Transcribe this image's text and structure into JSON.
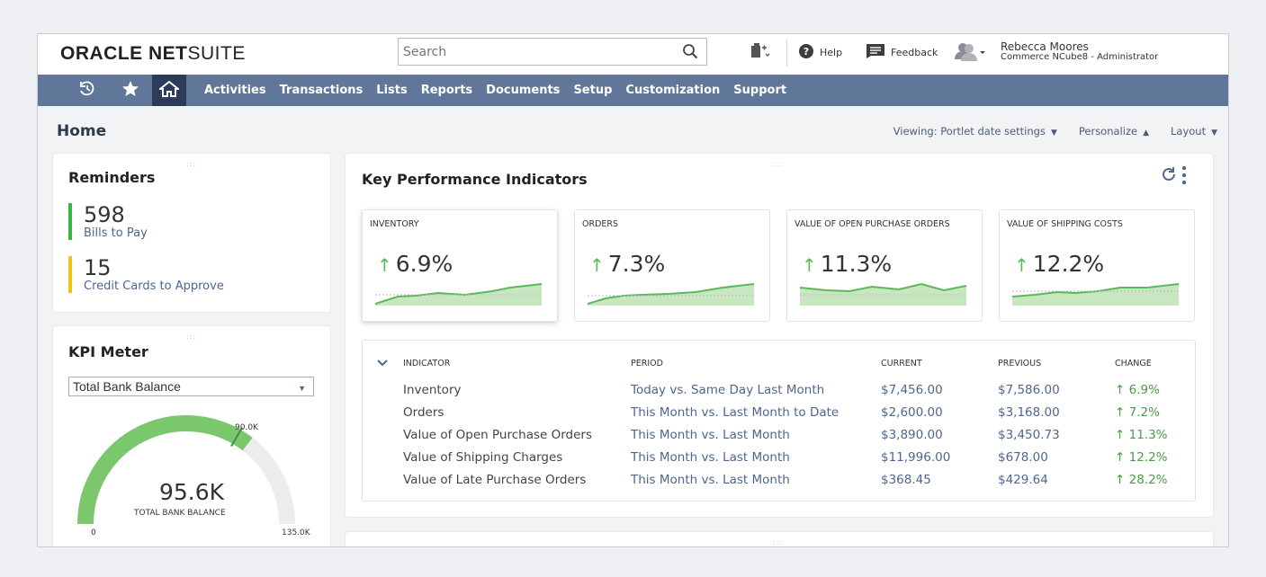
{
  "header": {
    "logo_bold": "ORACLE NET",
    "logo_light": "SUITE",
    "search": {
      "placeholder": "Search",
      "value": ""
    },
    "help_label": "Help",
    "feedback_label": "Feedback",
    "user_name": "Rebecca Moores",
    "user_role": "Commerce NCube8 - Administrator"
  },
  "nav": {
    "items": [
      "Activities",
      "Transactions",
      "Lists",
      "Reports",
      "Documents",
      "Setup",
      "Customization",
      "Support"
    ],
    "icons": [
      "recent-icon",
      "star-icon",
      "home-icon"
    ]
  },
  "page": {
    "title": "Home",
    "viewing": "Viewing: Portlet date settings",
    "personalize": "Personalize",
    "layout": "Layout"
  },
  "reminders": {
    "title": "Reminders",
    "items": [
      {
        "count": "598",
        "label": "Bills to Pay",
        "color": "#3bb54a"
      },
      {
        "count": "15",
        "label": "Credit Cards to Approve",
        "color": "#f0c419"
      }
    ]
  },
  "kpi_meter": {
    "title": "KPI Meter",
    "selected": "Total Bank Balance",
    "value": "95.6K",
    "caption": "TOTAL BANK BALANCE",
    "min_label": "0",
    "max_label": "135.0K",
    "target_label": "90.0K",
    "fill_fraction": 0.708,
    "target_fraction": 0.667
  },
  "kpi": {
    "title": "Key Performance Indicators",
    "cards": [
      {
        "label": "Inventory",
        "value": "6.9%"
      },
      {
        "label": "Orders",
        "value": "7.3%"
      },
      {
        "label": "Value of Open Purchase Orders",
        "value": "11.3%"
      },
      {
        "label": "Value of Shipping Costs",
        "value": "12.2%"
      }
    ],
    "table": {
      "headers": [
        "INDICATOR",
        "PERIOD",
        "CURRENT",
        "PREVIOUS",
        "CHANGE"
      ],
      "rows": [
        {
          "indicator": "Inventory",
          "period": "Today vs. Same Day Last Month",
          "current": "$7,456.00",
          "previous": "$7,586.00",
          "change": "6.9%"
        },
        {
          "indicator": "Orders",
          "period": "This Month vs. Last Month to Date",
          "current": "$2,600.00",
          "previous": "$3,168.00",
          "change": "7.2%"
        },
        {
          "indicator": "Value of Open Purchase Orders",
          "period": "This Month vs. Last Month",
          "current": "$3,890.00",
          "previous": "$3,450.73",
          "change": "11.3%"
        },
        {
          "indicator": "Value of Shipping Charges",
          "period": "This Month vs. Last Month",
          "current": "$11,996.00",
          "previous": "$678.00",
          "change": "12.2%"
        },
        {
          "indicator": "Value of Late Purchase Orders",
          "period": "This Month vs. Last Month",
          "current": "$368.45",
          "previous": "$429.64",
          "change": "28.2%"
        }
      ]
    }
  },
  "colors": {
    "nav_bg": "#607799",
    "nav_active": "#2b3b58",
    "positive": "#5cb85c",
    "link": "#4e6690"
  }
}
